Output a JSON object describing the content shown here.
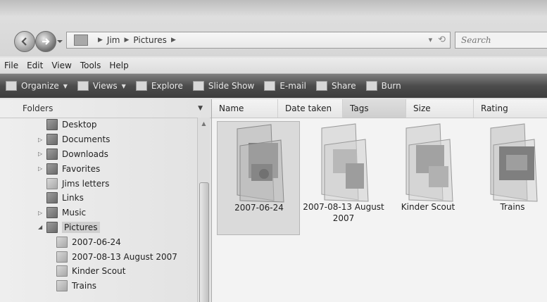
{
  "address": {
    "crumbs": [
      "Jim",
      "Pictures"
    ],
    "search_placeholder": "Search"
  },
  "menubar": [
    "File",
    "Edit",
    "View",
    "Tools",
    "Help"
  ],
  "toolbar": {
    "organize": "Organize",
    "views": "Views",
    "explore": "Explore",
    "slideshow": "Slide Show",
    "email": "E-mail",
    "share": "Share",
    "burn": "Burn"
  },
  "folders_pane": {
    "header": "Folders",
    "items": [
      {
        "label": "Desktop",
        "level": 0,
        "expandable": false
      },
      {
        "label": "Documents",
        "level": 0,
        "expandable": true
      },
      {
        "label": "Downloads",
        "level": 0,
        "expandable": true
      },
      {
        "label": "Favorites",
        "level": 0,
        "expandable": true
      },
      {
        "label": "Jims letters",
        "level": 0,
        "expandable": false
      },
      {
        "label": "Links",
        "level": 0,
        "expandable": false
      },
      {
        "label": "Music",
        "level": 0,
        "expandable": true
      },
      {
        "label": "Pictures",
        "level": 0,
        "expanded": true,
        "selected": true
      },
      {
        "label": "2007-06-24",
        "level": 1
      },
      {
        "label": "2007-08-13 August 2007",
        "level": 1
      },
      {
        "label": "Kinder Scout",
        "level": 1
      },
      {
        "label": "Trains",
        "level": 1
      }
    ]
  },
  "columns": [
    "Name",
    "Date taken",
    "Tags",
    "Size",
    "Rating"
  ],
  "tiles": [
    {
      "label": "2007-06-24",
      "selected": true
    },
    {
      "label": "2007-08-13 August 2007",
      "selected": false
    },
    {
      "label": "Kinder Scout",
      "selected": false
    },
    {
      "label": "Trains",
      "selected": false
    }
  ]
}
